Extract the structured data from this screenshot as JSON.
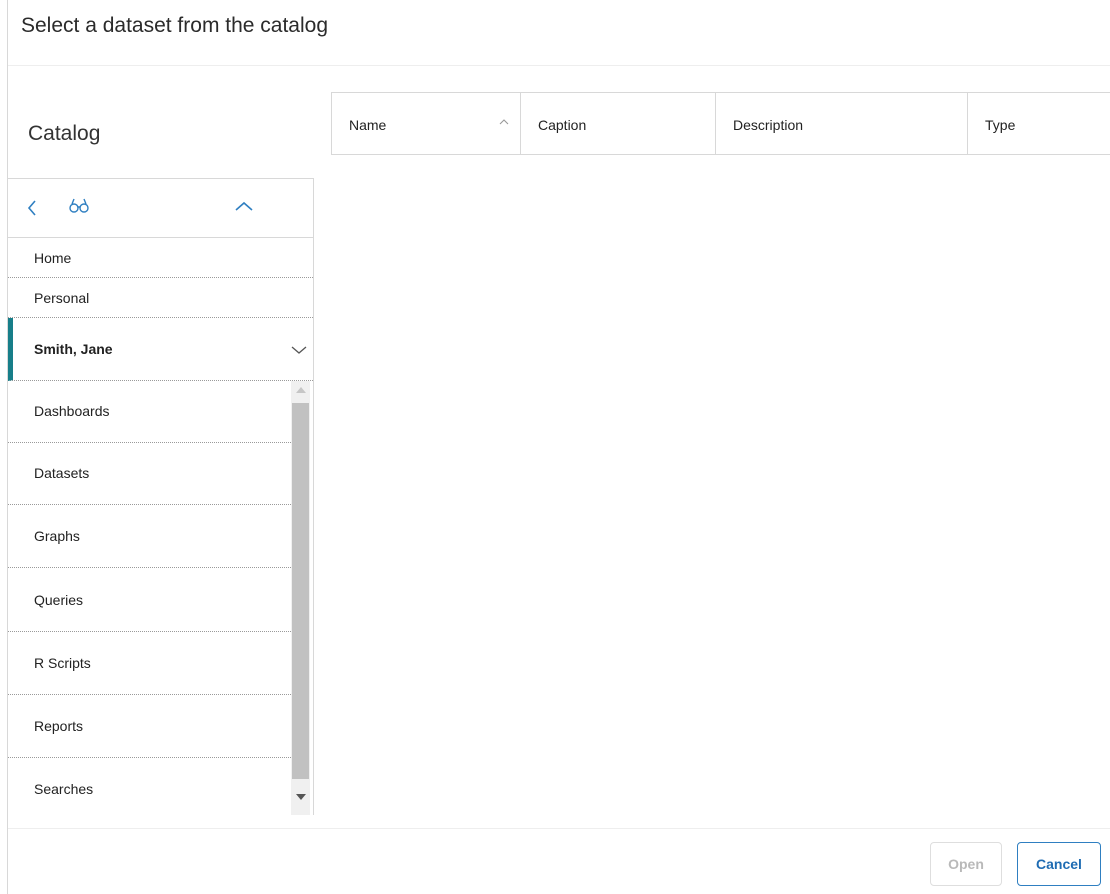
{
  "dialog": {
    "title": "Select a dataset from the catalog"
  },
  "catalog": {
    "heading": "Catalog",
    "toolbar": {
      "back_icon": "chevron-left-icon",
      "search_icon": "binoculars-icon",
      "collapse_icon": "chevron-up-icon"
    },
    "items": [
      {
        "label": "Home"
      },
      {
        "label": "Personal"
      },
      {
        "label": "Smith, Jane",
        "expanded": true
      }
    ],
    "sub_items": [
      {
        "label": "Dashboards"
      },
      {
        "label": "Datasets"
      },
      {
        "label": "Graphs"
      },
      {
        "label": "Queries"
      },
      {
        "label": "R Scripts"
      },
      {
        "label": "Reports"
      },
      {
        "label": "Searches"
      }
    ]
  },
  "table": {
    "columns": [
      {
        "label": "Name",
        "sort": "ascending"
      },
      {
        "label": "Caption"
      },
      {
        "label": "Description"
      },
      {
        "label": "Type"
      }
    ],
    "rows": []
  },
  "footer": {
    "open_label": "Open",
    "cancel_label": "Cancel"
  },
  "colors": {
    "accent": "#177e89",
    "primary_button": "#1f6cb3",
    "disabled_text": "#b9b9b9"
  }
}
